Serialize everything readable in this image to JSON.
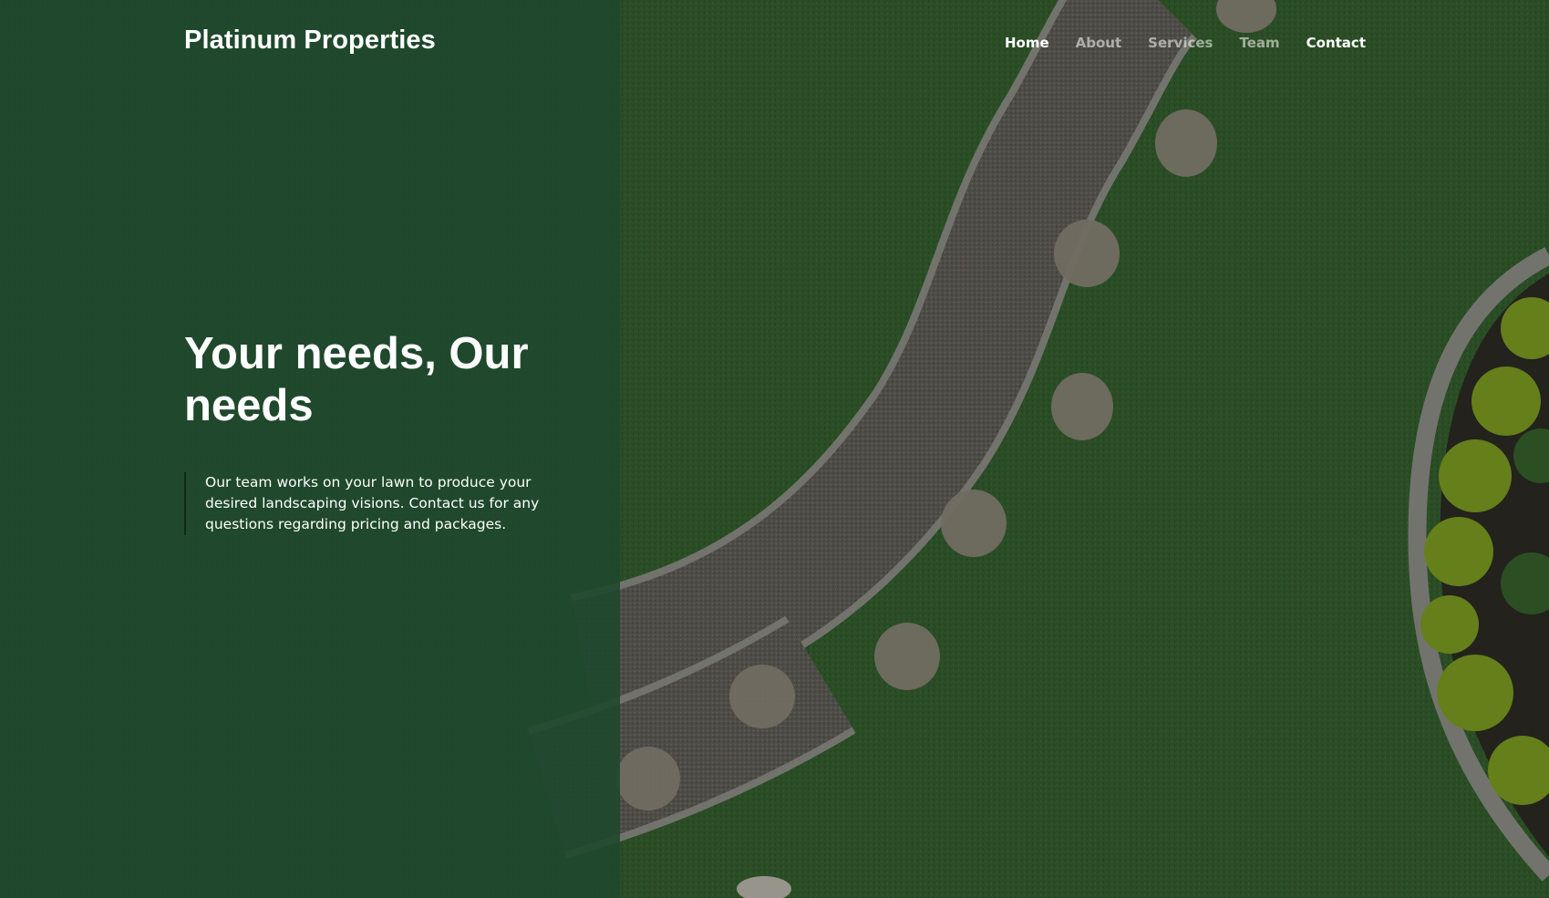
{
  "header": {
    "brand": "Platinum Properties",
    "nav": [
      {
        "label": "Home",
        "state": "active"
      },
      {
        "label": "About",
        "state": "muted"
      },
      {
        "label": "Services",
        "state": "muted"
      },
      {
        "label": "Team",
        "state": "muted"
      },
      {
        "label": "Contact",
        "state": "bright"
      }
    ]
  },
  "hero": {
    "title": "Your needs, Our needs",
    "text": "Our team works on your lawn to produce your desired landscaping visions. Contact us for any questions regarding pricing and packages."
  },
  "background": {
    "image": "aerial-lawn-stone-path",
    "colors": {
      "panel": "#1e482e",
      "grass": "#335c2d",
      "path": "#5e5c55",
      "stones": "#8c8678",
      "shrubs": "#7a9a22"
    }
  }
}
